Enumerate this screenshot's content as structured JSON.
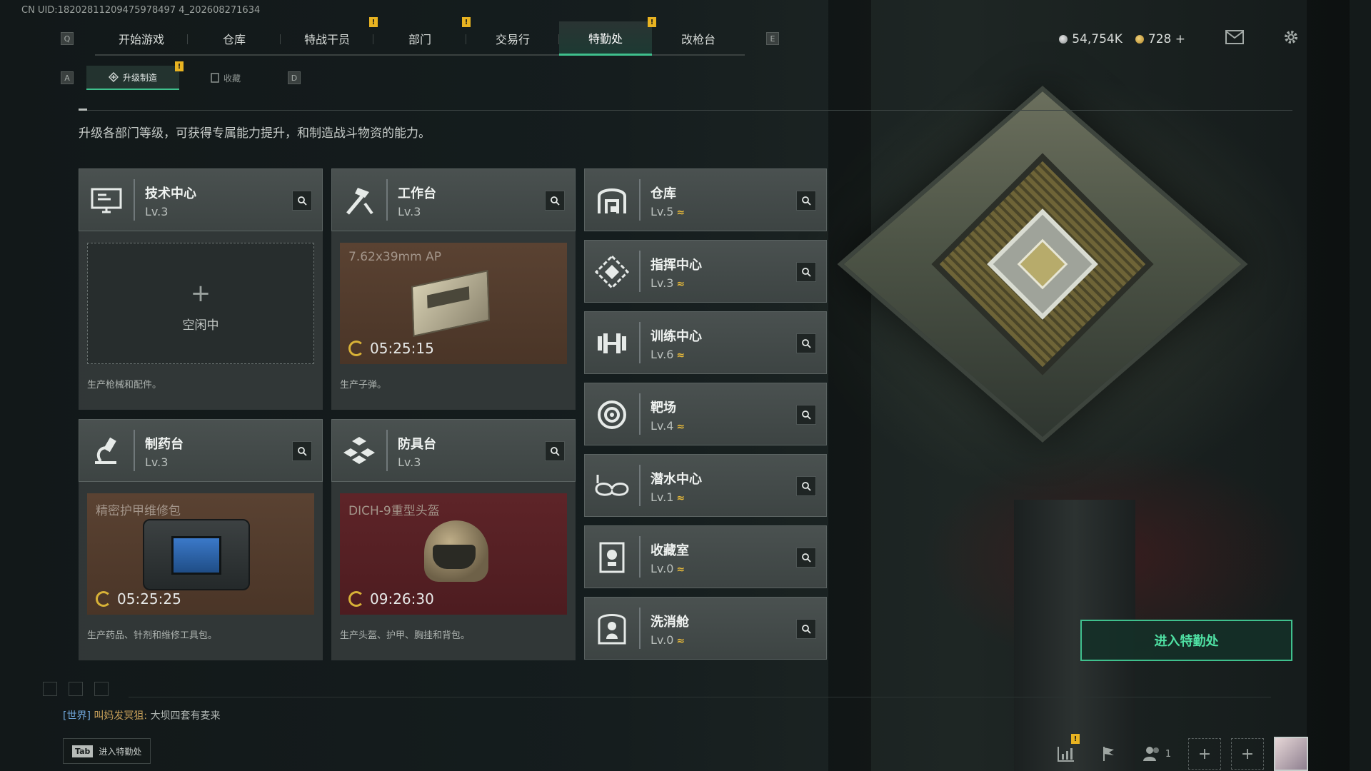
{
  "uid": "CN UID:18202811209475978497 4_202608271634",
  "nav": {
    "left_key": "Q",
    "right_key": "E",
    "tabs": [
      {
        "label": "开始游戏",
        "badge": false
      },
      {
        "label": "仓库",
        "badge": false
      },
      {
        "label": "特战干员",
        "badge": true
      },
      {
        "label": "部门",
        "badge": true
      },
      {
        "label": "交易行",
        "badge": false
      },
      {
        "label": "特勤处",
        "badge": true,
        "active": true
      },
      {
        "label": "改枪台",
        "badge": false
      }
    ],
    "badge_text": "!"
  },
  "currency": {
    "silver": "54,754K",
    "gold": "728",
    "gold_plus": "+"
  },
  "subnav": {
    "left_key": "A",
    "right_key": "D",
    "tabs": [
      {
        "label": "升级制造",
        "active": true,
        "badge": true
      },
      {
        "label": "收藏",
        "active": false
      }
    ]
  },
  "description": "升级各部门等级，可获得专属能力提升，和制造战斗物资的能力。",
  "workshops": [
    {
      "title": "技术中心",
      "level": "Lv.3",
      "icon": "tech-center-icon",
      "status": "idle",
      "idle_plus": "+",
      "idle_text": "空闲中",
      "footer": "生产枪械和配件。"
    },
    {
      "title": "工作台",
      "level": "Lv.3",
      "icon": "workbench-icon",
      "status": "producing",
      "item": "7.62x39mm AP",
      "timer": "05:25:15",
      "footer": "生产子弹。"
    },
    {
      "title": "制药台",
      "level": "Lv.3",
      "icon": "pharmacy-icon",
      "status": "producing",
      "item": "精密护甲维修包",
      "timer": "05:25:25",
      "footer": "生产药品、针剂和维修工具包。"
    },
    {
      "title": "防具台",
      "level": "Lv.3",
      "icon": "armor-bench-icon",
      "status": "producing",
      "item": "DICH-9重型头盔",
      "timer": "09:26:30",
      "footer": "生产头盔、护甲、胸挂和背包。"
    }
  ],
  "departments": [
    {
      "title": "仓库",
      "level": "Lv.5",
      "icon": "warehouse-icon"
    },
    {
      "title": "指挥中心",
      "level": "Lv.3",
      "icon": "command-center-icon"
    },
    {
      "title": "训练中心",
      "level": "Lv.6",
      "icon": "dumbbell-icon"
    },
    {
      "title": "靶场",
      "level": "Lv.4",
      "icon": "target-icon"
    },
    {
      "title": "潜水中心",
      "level": "Lv.1",
      "icon": "diving-goggles-icon"
    },
    {
      "title": "收藏室",
      "level": "Lv.0",
      "icon": "trophy-room-icon"
    },
    {
      "title": "洗消舱",
      "level": "Lv.0",
      "icon": "decon-chamber-icon"
    }
  ],
  "level_up_glyph": "≈",
  "enter_button": "进入特勤处",
  "chat": {
    "channel": "[世界]",
    "name": "叫妈发冥狙:",
    "message": "大坝四套有麦来"
  },
  "tab_hint": {
    "key": "Tab",
    "label": "进入特勤处"
  },
  "bottom": {
    "friends_count": "1"
  },
  "colors": {
    "accent": "#3fc08d",
    "badge": "#e8b321",
    "level_up": "#e5b83a"
  }
}
